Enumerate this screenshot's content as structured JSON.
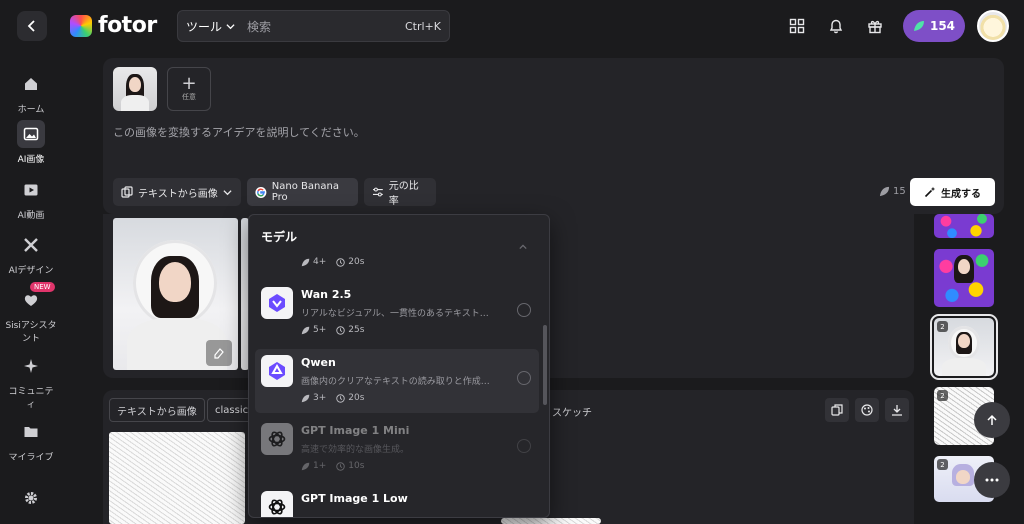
{
  "topbar": {
    "logo_text": "fotor",
    "search": {
      "tool_label": "ツール",
      "placeholder": "検索",
      "shortcut": "Ctrl+K"
    },
    "credits": "154"
  },
  "sidebar": {
    "items": [
      {
        "label": "ホーム"
      },
      {
        "label": "AI画像"
      },
      {
        "label": "AI動画"
      },
      {
        "label": "AIデザイン"
      },
      {
        "label": "Sisiアシスタント",
        "badge": "NEW"
      },
      {
        "label": "コミュニティ"
      },
      {
        "label": "マイライブ"
      }
    ]
  },
  "prompt": {
    "add_ref_label": "任意",
    "placeholder": "この画像を変換するアイデアを説明してください。",
    "mode_label": "テキストから画像",
    "model_label": "Nano Banana Pro",
    "ratio_label": "元の比率",
    "cost": "15",
    "generate_label": "生成する"
  },
  "result2": {
    "tags": [
      "テキストから画像",
      "classic"
    ],
    "style_text": "スケッチ"
  },
  "strip": {
    "badges": [
      "2",
      "2",
      "2"
    ]
  },
  "dropdown": {
    "title": "モデル",
    "partial_meta": {
      "credits": "4+",
      "time": "20s"
    },
    "models": [
      {
        "name": "Wan 2.5",
        "desc": "リアルなビジュアル、一貫性のあるテキスト…",
        "credits": "5+",
        "time": "25s"
      },
      {
        "name": "Qwen",
        "desc": "画像内のクリアなテキストの読み取りと作成…",
        "credits": "3+",
        "time": "20s"
      },
      {
        "name": "GPT Image 1 Mini",
        "desc": "高速で効率的な画像生成。",
        "credits": "1+",
        "time": "10s"
      },
      {
        "name": "GPT Image 1 Low",
        "desc": "",
        "credits": "",
        "time": ""
      }
    ]
  },
  "colors": {
    "accent": "#7e4fc7",
    "panel": "#242428",
    "background": "#1b1b1d",
    "badge": "#e0356b"
  }
}
